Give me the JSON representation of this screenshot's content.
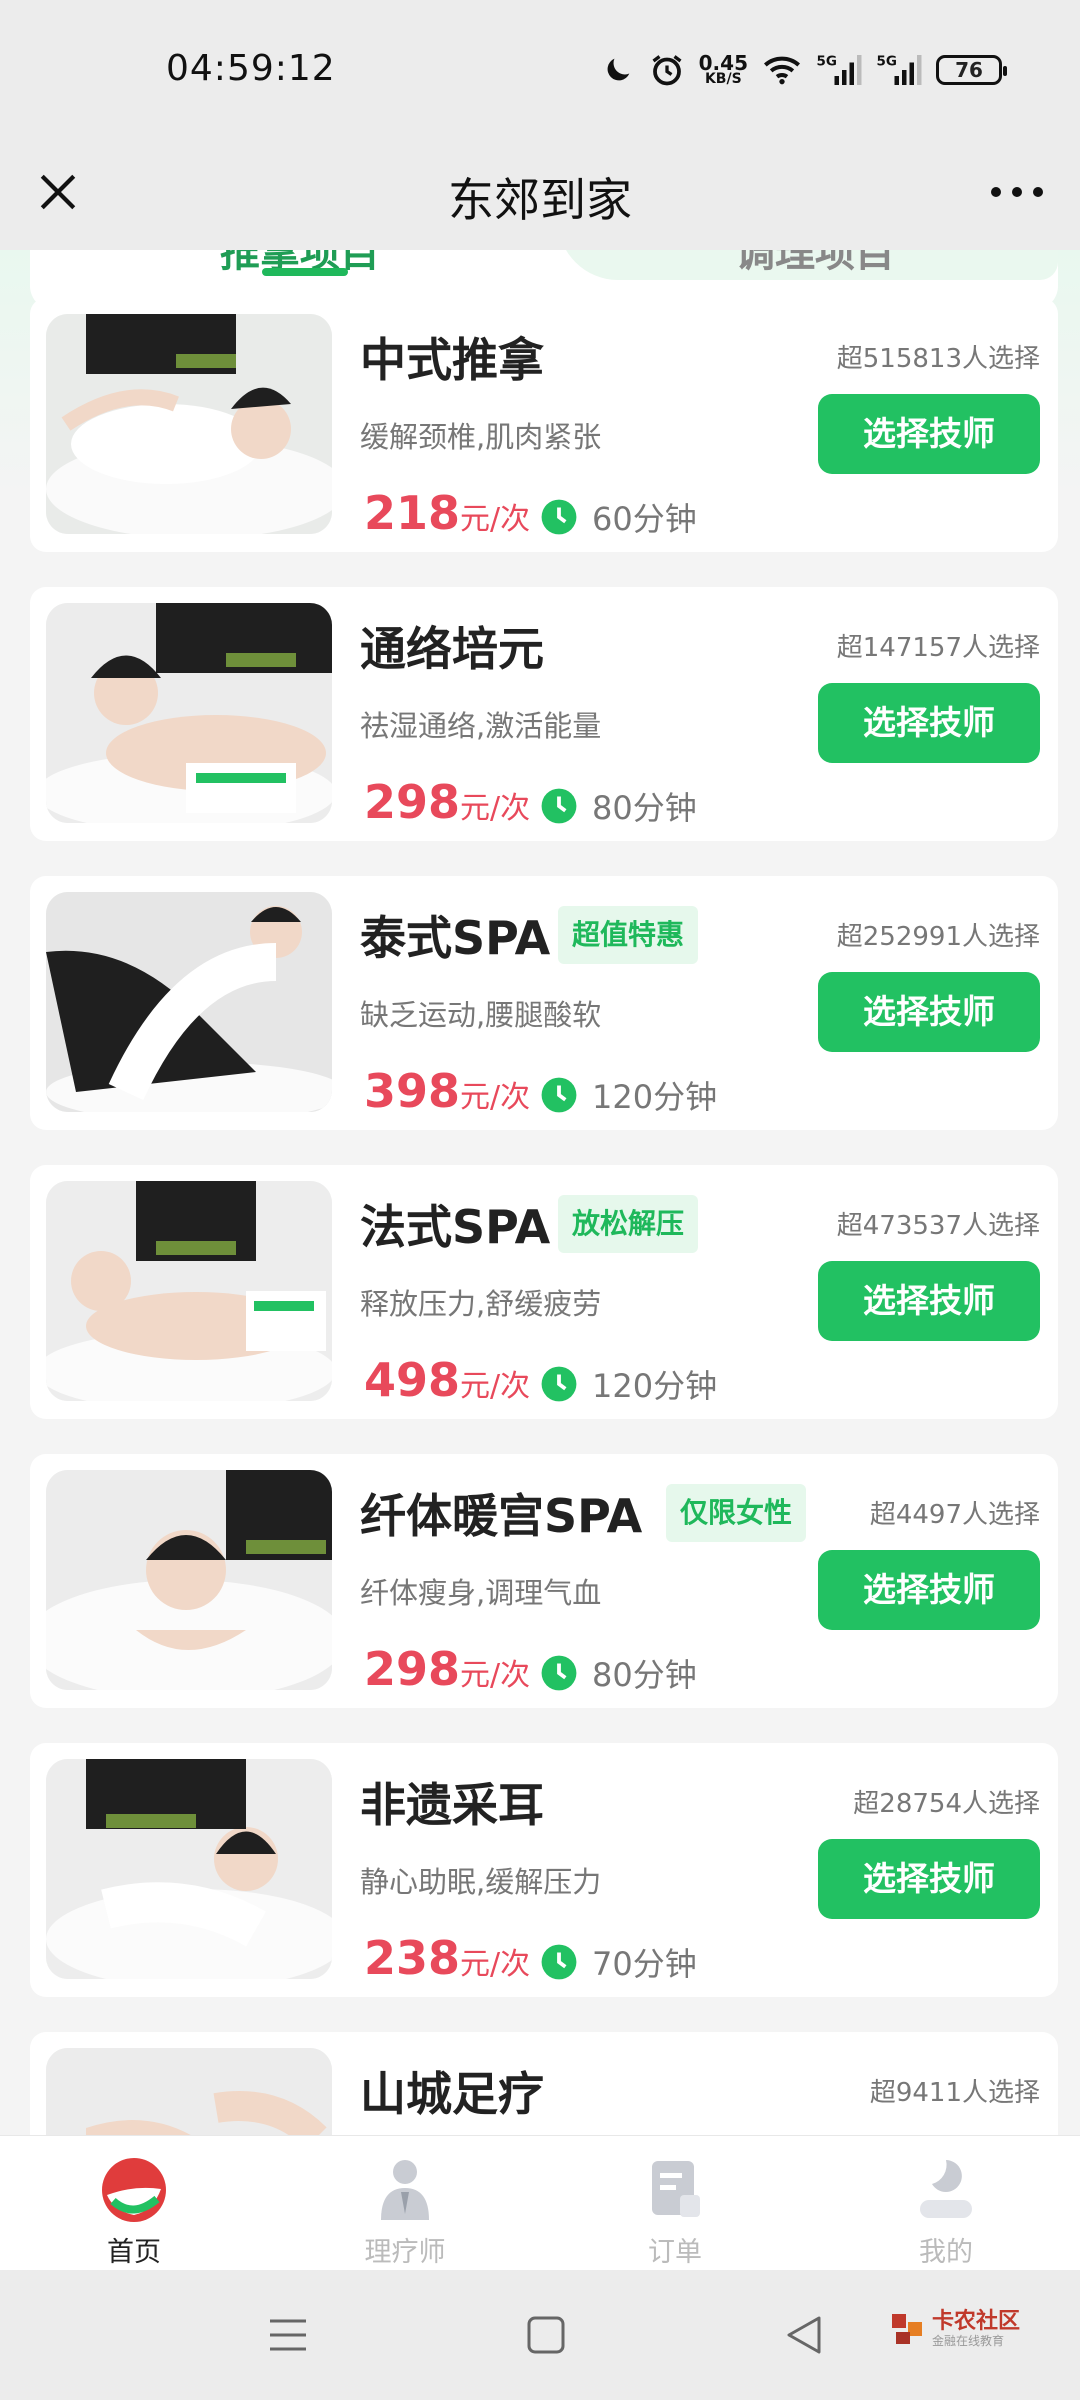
{
  "status_bar": {
    "time": "04:59:12",
    "net_speed_value": "0.45",
    "net_speed_unit": "KB/S",
    "signal1": "5G",
    "signal2": "5G",
    "battery": "76",
    "icons": [
      "moon-icon",
      "alarm-icon",
      "wifi-icon",
      "signal-icon",
      "signal-icon",
      "battery-icon"
    ]
  },
  "header": {
    "title": "东郊到家",
    "close_icon": "close-icon",
    "more_icon": "more-icon"
  },
  "tabs": [
    {
      "label": "推拿项目"
    },
    {
      "label": "调理项目"
    }
  ],
  "services": [
    {
      "name": "中式推拿",
      "badge": "",
      "chosen": "超515813人选择",
      "desc": "缓解颈椎,肌肉紧张",
      "price": "218",
      "unit": "元/次",
      "duration": "60分钟",
      "button": "选择技师"
    },
    {
      "name": "通络培元",
      "badge": "",
      "chosen": "超147157人选择",
      "desc": "祛湿通络,激活能量",
      "price": "298",
      "unit": "元/次",
      "duration": "80分钟",
      "button": "选择技师"
    },
    {
      "name": "泰式SPA",
      "badge": "超值特惠",
      "chosen": "超252991人选择",
      "desc": "缺乏运动,腰腿酸软",
      "price": "398",
      "unit": "元/次",
      "duration": "120分钟",
      "button": "选择技师"
    },
    {
      "name": "法式SPA",
      "badge": "放松解压",
      "chosen": "超473537人选择",
      "desc": "释放压力,舒缓疲劳",
      "price": "498",
      "unit": "元/次",
      "duration": "120分钟",
      "button": "选择技师"
    },
    {
      "name": "纤体暖宫SPA",
      "badge": "仅限女性",
      "chosen": "超4497人选择",
      "desc": "纤体瘦身,调理气血",
      "price": "298",
      "unit": "元/次",
      "duration": "80分钟",
      "button": "选择技师"
    },
    {
      "name": "非遗采耳",
      "badge": "",
      "chosen": "超28754人选择",
      "desc": "静心助眠,缓解压力",
      "price": "238",
      "unit": "元/次",
      "duration": "70分钟",
      "button": "选择技师"
    },
    {
      "name": "山城足疗",
      "badge": "",
      "chosen": "超9411人选择",
      "desc": "",
      "price": "",
      "unit": "",
      "duration": "",
      "button": ""
    }
  ],
  "bottom_nav": [
    {
      "label": "首页",
      "icon": "home-logo-icon",
      "active": true
    },
    {
      "label": "理疗师",
      "icon": "therapist-icon",
      "active": false
    },
    {
      "label": "订单",
      "icon": "order-icon",
      "active": false
    },
    {
      "label": "我的",
      "icon": "profile-icon",
      "active": false
    }
  ],
  "watermark": {
    "title": "卡农社区",
    "sub": "金融在线教育"
  },
  "colors": {
    "brand_green": "#22c162",
    "price_red": "#e8495b",
    "badge_bg": "#e6f8ec"
  }
}
